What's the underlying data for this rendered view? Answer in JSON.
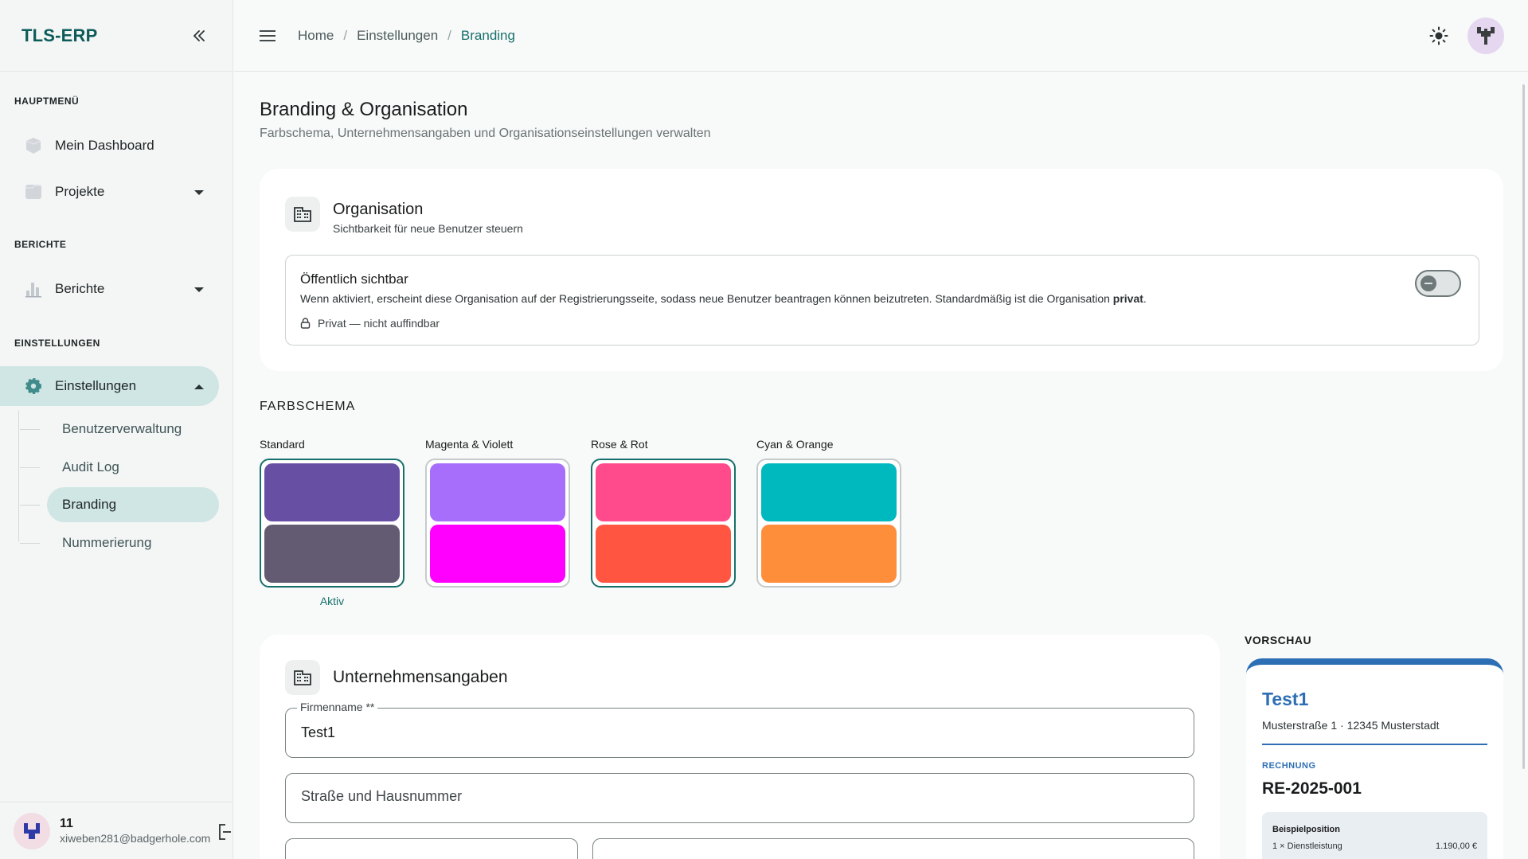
{
  "app": {
    "brand": "TLS-ERP"
  },
  "sidebar": {
    "sections": {
      "main": "HAUPTMENÜ",
      "reports": "BERICHTE",
      "settings": "EINSTELLUNGEN"
    },
    "items": {
      "dashboard": "Mein Dashboard",
      "projects": "Projekte",
      "reports": "Berichte",
      "settings": "Einstellungen"
    },
    "subitems": [
      "Benutzerverwaltung",
      "Audit Log",
      "Branding",
      "Nummerierung"
    ],
    "user": {
      "name": "11",
      "email": "xiweben281@badgerhole.com"
    }
  },
  "breadcrumb": [
    "Home",
    "Einstellungen",
    "Branding"
  ],
  "page": {
    "title": "Branding & Organisation",
    "subtitle": "Farbschema, Unternehmensangaben und Organisationseinstellungen verwalten"
  },
  "organisation": {
    "title": "Organisation",
    "subtitle": "Sichtbarkeit für neue Benutzer steuern",
    "public_title": "Öffentlich sichtbar",
    "public_desc": "Wenn aktiviert, erscheint diese Organisation auf der Registrierungsseite, sodass neue Benutzer beantragen können beizutreten. Standardmäßig ist die Organisation",
    "public_desc_bold": "privat",
    "public_desc_end": ".",
    "status": "Privat — nicht auffindbar",
    "public_enabled": false
  },
  "color_scheme": {
    "label": "FARBSCHEMA",
    "active_label": "Aktiv",
    "schemes": [
      {
        "name": "Standard",
        "primary": "#6750a4",
        "secondary": "#625b71",
        "selected": true,
        "active": true
      },
      {
        "name": "Magenta & Violett",
        "primary": "#a66efa",
        "secondary": "#ff00ff",
        "selected": false,
        "active": false
      },
      {
        "name": "Rose & Rot",
        "primary": "#ff4b8c",
        "secondary": "#ff5541",
        "selected": true,
        "active": false
      },
      {
        "name": "Cyan & Orange",
        "primary": "#00b9bf",
        "secondary": "#ff8e3a",
        "selected": false,
        "active": false
      }
    ]
  },
  "company": {
    "title": "Unternehmensangaben",
    "name_label": "Firmenname **",
    "name_value": "Test1",
    "street_placeholder": "Straße und Hausnummer"
  },
  "preview": {
    "label": "VORSCHAU",
    "company": "Test1",
    "address": "Musterstraße 1 · 12345 Musterstadt",
    "doc_type": "RECHNUNG",
    "doc_number": "RE-2025-001",
    "item_name": "Beispielposition",
    "item_qty": "1 × Dienstleistung",
    "item_price": "1.190,00 €",
    "accent": "#2d6fb4"
  },
  "colors": {
    "brand": "#0d5c5a",
    "accent": "#17706c",
    "active_bg": "#cfe6e4"
  }
}
